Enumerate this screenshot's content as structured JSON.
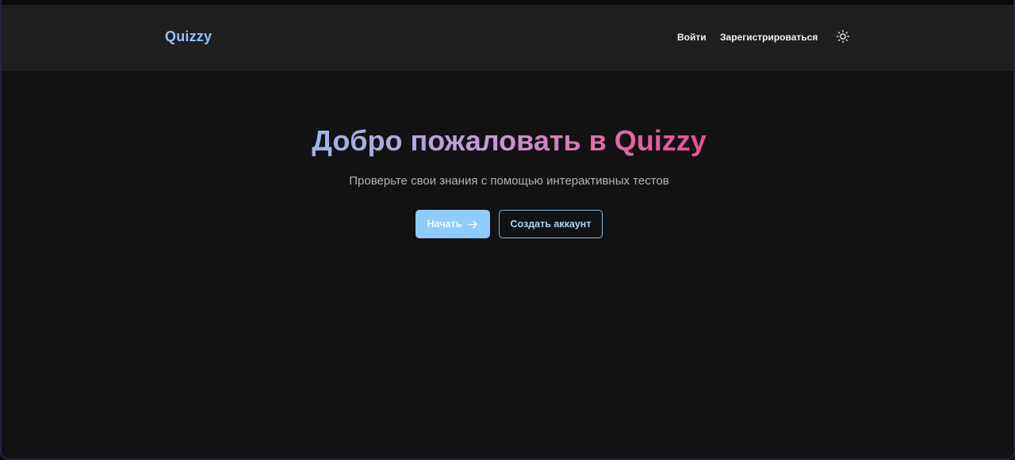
{
  "header": {
    "logo": "Quizzy",
    "nav": {
      "login": "Войти",
      "register": "Зарегистрироваться"
    },
    "theme_toggle_icon": "sun-icon"
  },
  "hero": {
    "title": "Добро пожаловать в Quizzy",
    "subtitle": "Проверьте свои знания с помощью интерактивных тестов",
    "primary_button": "Начать",
    "primary_button_icon": "arrow-right-icon",
    "secondary_button": "Создать аккаунт"
  },
  "colors": {
    "background": "#121213",
    "navbar": "#1e1e1f",
    "accent": "#8ecbff",
    "gradient_start": "#9fb4e6",
    "gradient_end": "#ec4f8f"
  }
}
